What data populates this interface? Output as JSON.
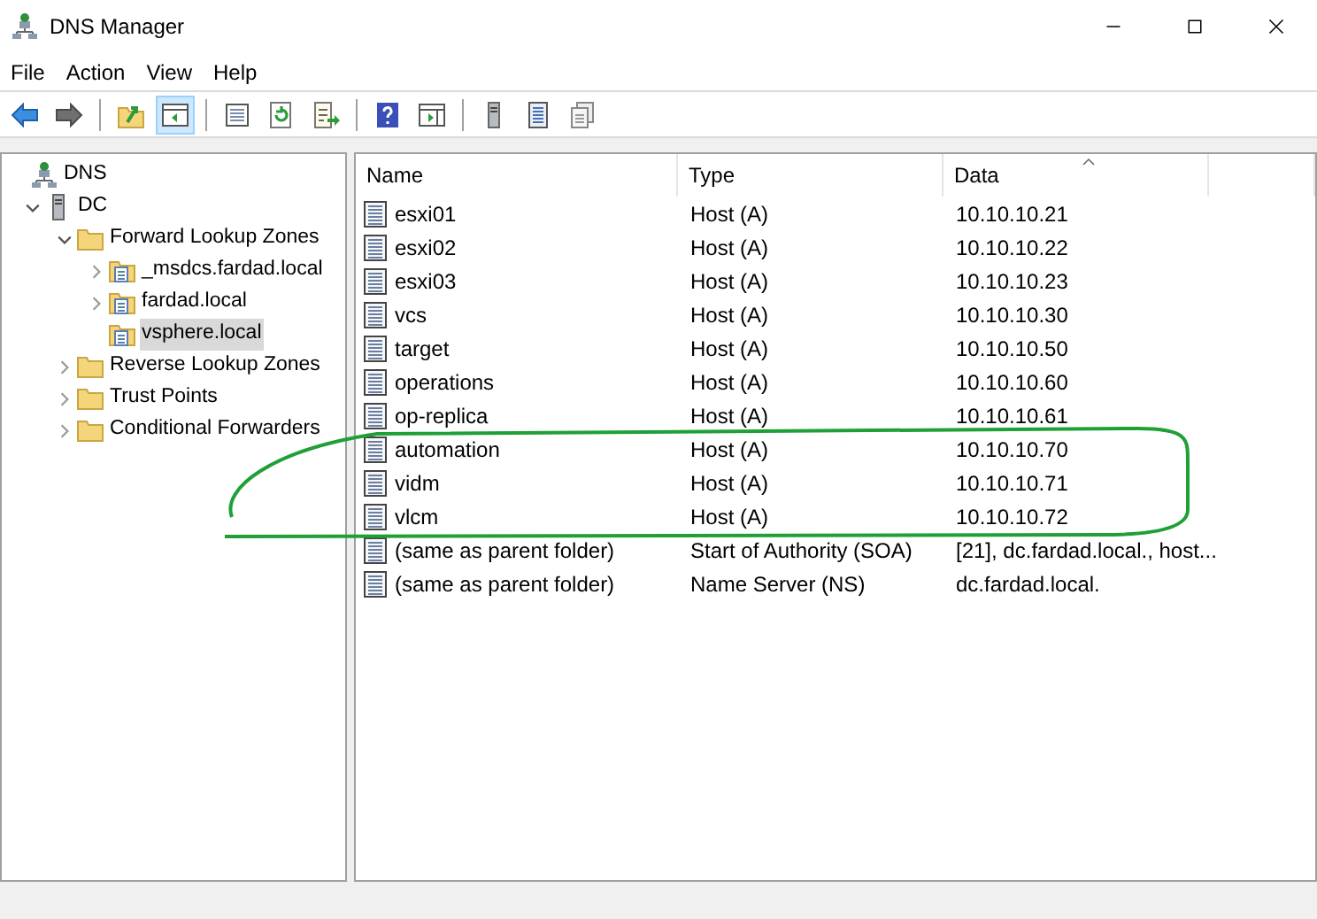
{
  "window": {
    "title": "DNS Manager"
  },
  "menu": [
    "File",
    "Action",
    "View",
    "Help"
  ],
  "toolbar": [
    {
      "kind": "back",
      "selected": false
    },
    {
      "kind": "forward",
      "selected": false
    },
    {
      "kind": "sep"
    },
    {
      "kind": "up",
      "selected": false
    },
    {
      "kind": "tree",
      "selected": true
    },
    {
      "kind": "sep"
    },
    {
      "kind": "props",
      "selected": false
    },
    {
      "kind": "refresh",
      "selected": false
    },
    {
      "kind": "export",
      "selected": false
    },
    {
      "kind": "sep"
    },
    {
      "kind": "help",
      "selected": false
    },
    {
      "kind": "pane",
      "selected": false
    },
    {
      "kind": "sep"
    },
    {
      "kind": "server",
      "selected": false
    },
    {
      "kind": "list",
      "selected": false
    },
    {
      "kind": "copy",
      "selected": false
    }
  ],
  "tree": [
    {
      "label": "DNS",
      "kind": "dns",
      "selected": false,
      "children": [
        {
          "label": "DC",
          "kind": "server",
          "expanded": true,
          "selected": false,
          "children": [
            {
              "label": "Forward Lookup Zones",
              "kind": "folder",
              "expanded": true,
              "selected": false,
              "children": [
                {
                  "label": "_msdcs.fardad.local",
                  "kind": "zone",
                  "expanded": false,
                  "selected": false
                },
                {
                  "label": "fardad.local",
                  "kind": "zone",
                  "expanded": false,
                  "selected": false
                },
                {
                  "label": "vsphere.local",
                  "kind": "zone",
                  "selected": true
                }
              ]
            },
            {
              "label": "Reverse Lookup Zones",
              "kind": "folder",
              "expanded": false,
              "selected": false
            },
            {
              "label": "Trust Points",
              "kind": "folder",
              "expanded": false,
              "selected": false
            },
            {
              "label": "Conditional Forwarders",
              "kind": "folder",
              "expanded": false,
              "selected": false
            }
          ]
        }
      ]
    }
  ],
  "table": {
    "columns": [
      {
        "label": "Name"
      },
      {
        "label": "Type"
      },
      {
        "label": "Data",
        "sorted": true
      }
    ],
    "rows": [
      {
        "name": "esxi01",
        "type": "Host (A)",
        "data": "10.10.10.21",
        "circled": false
      },
      {
        "name": "esxi02",
        "type": "Host (A)",
        "data": "10.10.10.22",
        "circled": false
      },
      {
        "name": "esxi03",
        "type": "Host (A)",
        "data": "10.10.10.23",
        "circled": false
      },
      {
        "name": "vcs",
        "type": "Host (A)",
        "data": "10.10.10.30",
        "circled": false
      },
      {
        "name": "target",
        "type": "Host (A)",
        "data": "10.10.10.50",
        "circled": false
      },
      {
        "name": "operations",
        "type": "Host (A)",
        "data": "10.10.10.60",
        "circled": false
      },
      {
        "name": "op-replica",
        "type": "Host (A)",
        "data": "10.10.10.61",
        "circled": false
      },
      {
        "name": "automation",
        "type": "Host (A)",
        "data": "10.10.10.70",
        "circled": true
      },
      {
        "name": "vidm",
        "type": "Host (A)",
        "data": "10.10.10.71",
        "circled": true
      },
      {
        "name": "vlcm",
        "type": "Host (A)",
        "data": "10.10.10.72",
        "circled": true
      },
      {
        "name": "(same as parent folder)",
        "type": "Start of Authority (SOA)",
        "data": "[21], dc.fardad.local., host...",
        "circled": false
      },
      {
        "name": "(same as parent folder)",
        "type": "Name Server (NS)",
        "data": "dc.fardad.local.",
        "circled": false
      }
    ]
  }
}
